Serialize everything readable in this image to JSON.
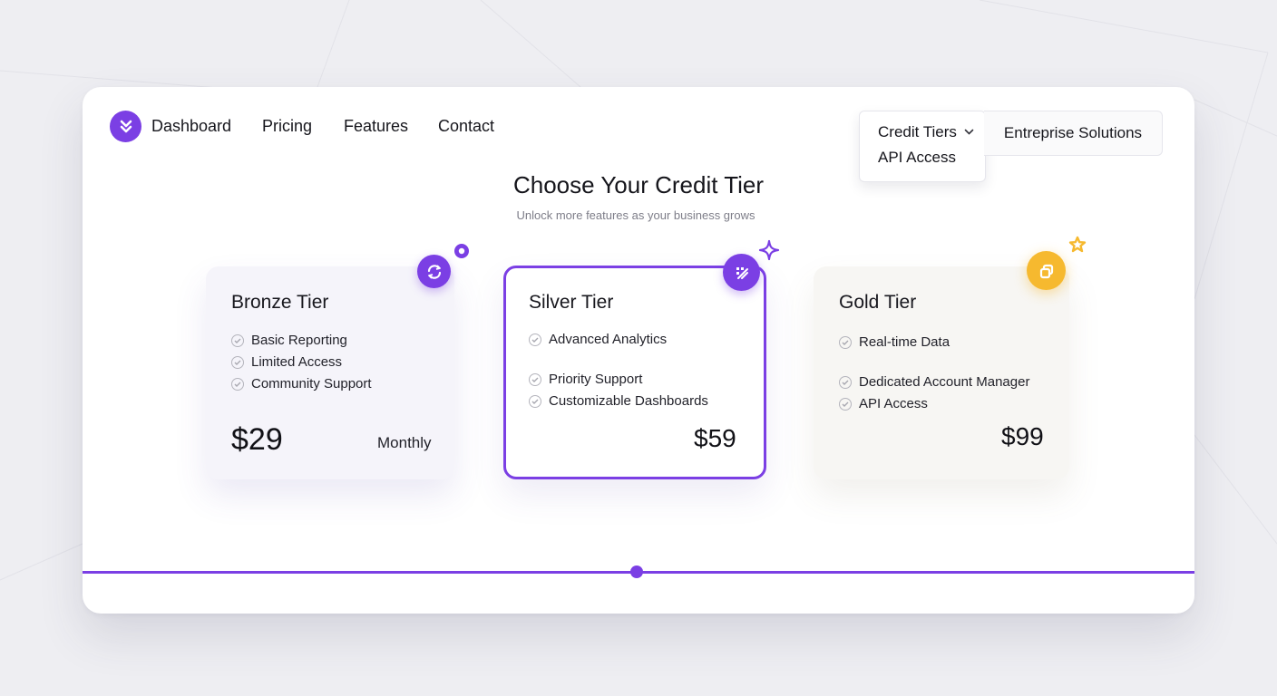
{
  "colors": {
    "accent": "#7b3fe4",
    "gold_accent": "#f6b92f",
    "background": "#eeeef2"
  },
  "nav": {
    "logo_icon": "chevron-double-down-icon",
    "links": [
      "Dashboard",
      "Pricing",
      "Features",
      "Contact"
    ]
  },
  "dropdown": {
    "selected": "Credit Tiers",
    "options": [
      "API Access"
    ]
  },
  "enterprise_button": "Entreprise Solutions",
  "heading": {
    "title": "Choose Your Credit Tier",
    "subtitle": "Unlock more features as your business grows"
  },
  "tiers": [
    {
      "name": "Bronze Tier",
      "features": [
        "Basic Reporting",
        "Limited Access",
        "Community Support"
      ],
      "price": "$29",
      "period": "Monthly",
      "icon": "refresh-cycle-icon"
    },
    {
      "name": "Silver Tier",
      "features": [
        "Advanced Analytics",
        "Priority Support",
        "Customizable Dashboards"
      ],
      "price": "$59",
      "icon": "analytics-icon"
    },
    {
      "name": "Gold Tier",
      "features": [
        "Real-time Data",
        "Dedicated Account Manager",
        "API Access"
      ],
      "price": "$99",
      "icon": "stack-icon"
    }
  ]
}
